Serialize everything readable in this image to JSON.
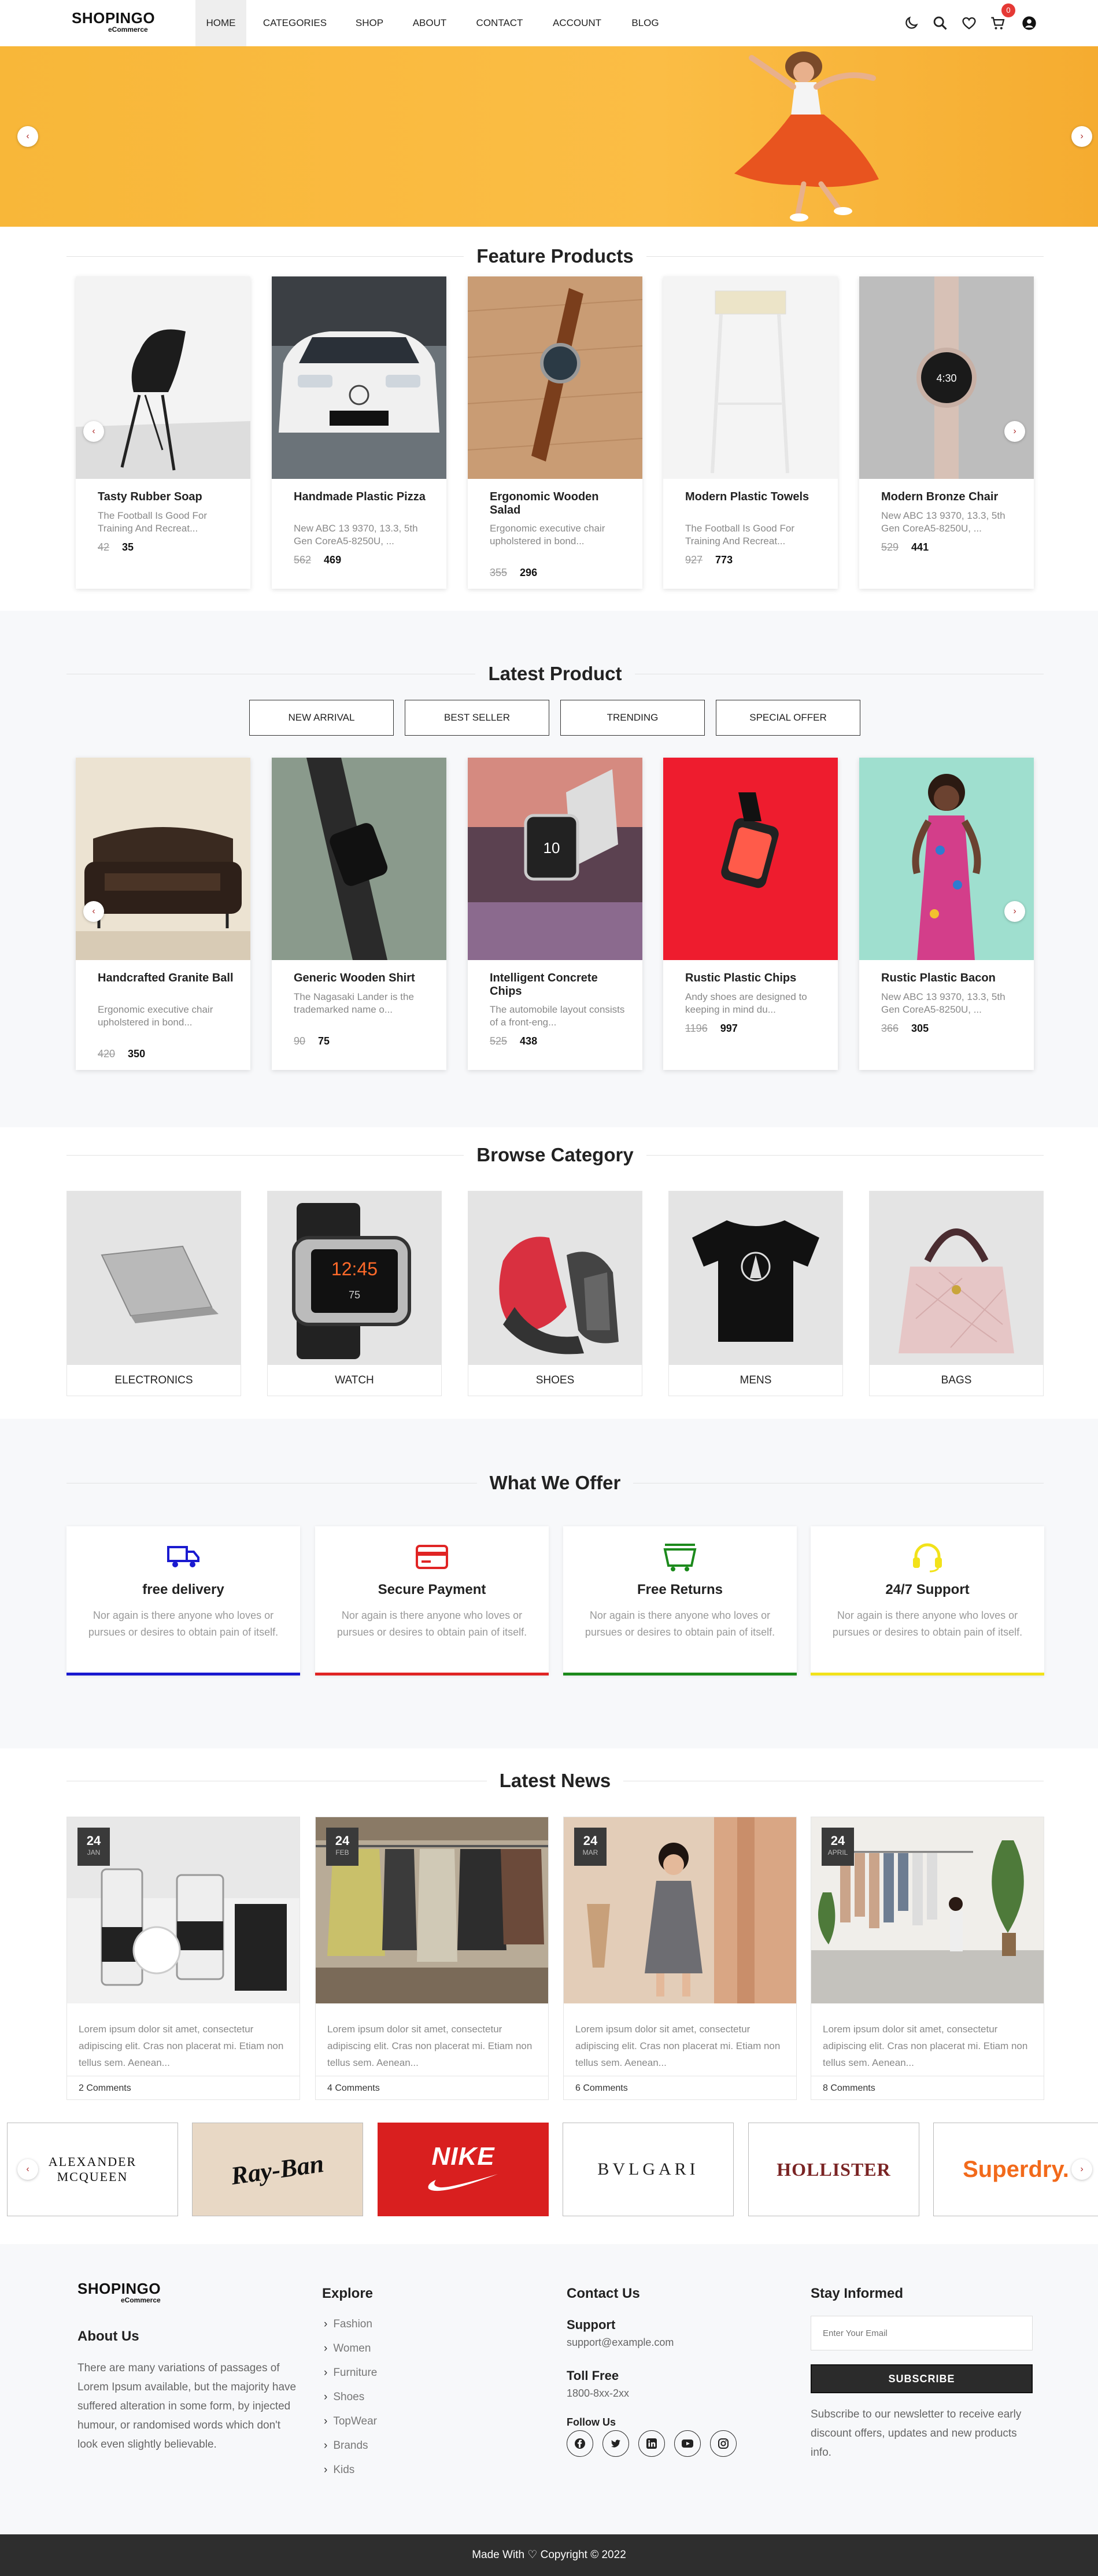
{
  "header": {
    "logo": "SHOPINGO",
    "logo_sub": "eCommerce",
    "nav": [
      "HOME",
      "CATEGORIES",
      "SHOP",
      "ABOUT",
      "CONTACT",
      "ACCOUNT",
      "BLOG"
    ],
    "cart_count": "0",
    "icons": [
      "moon-icon",
      "search-icon",
      "heart-icon",
      "cart-icon",
      "user-icon"
    ]
  },
  "hero": {
    "arrows": [
      "chevron-left-icon",
      "chevron-right-icon"
    ]
  },
  "feature": {
    "title": "Feature Products",
    "products": [
      {
        "name": "Tasty Rubber Soap",
        "desc": "The Football Is Good For Training And Recreat...",
        "old": "42",
        "price": "35"
      },
      {
        "name": "Handmade Plastic Pizza",
        "desc": "New ABC 13 9370, 13.3, 5th Gen CoreA5-8250U, ...",
        "old": "562",
        "price": "469"
      },
      {
        "name": "Ergonomic Wooden Salad",
        "desc": "Ergonomic executive chair upholstered in bond...",
        "old": "355",
        "price": "296"
      },
      {
        "name": "Modern Plastic Towels",
        "desc": "The Football Is Good For Training And Recreat...",
        "old": "927",
        "price": "773"
      },
      {
        "name": "Modern Bronze Chair",
        "desc": "New ABC 13 9370, 13.3, 5th Gen CoreA5-8250U, ...",
        "old": "529",
        "price": "441"
      }
    ]
  },
  "latest": {
    "title": "Latest Product",
    "tabs": [
      "NEW ARRIVAL",
      "BEST SELLER",
      "TRENDING",
      "SPECIAL OFFER"
    ],
    "products": [
      {
        "name": "Handcrafted Granite Ball",
        "desc": "Ergonomic executive chair upholstered in bond...",
        "old": "420",
        "price": "350"
      },
      {
        "name": "Generic Wooden Shirt",
        "desc": "The Nagasaki Lander is the trademarked name o...",
        "old": "90",
        "price": "75"
      },
      {
        "name": "Intelligent Concrete Chips",
        "desc": "The automobile layout consists of a front-eng...",
        "old": "525",
        "price": "438"
      },
      {
        "name": "Rustic Plastic Chips",
        "desc": "Andy shoes are designed to keeping in mind du...",
        "old": "1196",
        "price": "997"
      },
      {
        "name": "Rustic Plastic Bacon",
        "desc": "New ABC 13 9370, 13.3, 5th Gen CoreA5-8250U, ...",
        "old": "366",
        "price": "305"
      }
    ]
  },
  "category": {
    "title": "Browse Category",
    "items": [
      "ELECTRONICS",
      "WATCH",
      "SHOES",
      "MENS",
      "BAGS"
    ]
  },
  "offer": {
    "title": "What We Offer",
    "items": [
      {
        "title": "free delivery",
        "text": "Nor again is there anyone who loves or pursues or desires to obtain pain of itself.",
        "color": "#1a1ad0",
        "icon": "truck-icon"
      },
      {
        "title": "Secure Payment",
        "text": "Nor again is there anyone who loves or pursues or desires to obtain pain of itself.",
        "color": "#e02424",
        "icon": "credit-card-icon"
      },
      {
        "title": "Free Returns",
        "text": "Nor again is there anyone who loves or pursues or desires to obtain pain of itself.",
        "color": "#1c8a1c",
        "icon": "basket-icon"
      },
      {
        "title": "24/7 Support",
        "text": "Nor again is there anyone who loves or pursues or desires to obtain pain of itself.",
        "color": "#f2e21a",
        "icon": "headset-icon"
      }
    ]
  },
  "news": {
    "title": "Latest News",
    "items": [
      {
        "day": "24",
        "month": "JAN",
        "text": "Lorem ipsum dolor sit amet, consectetur adipiscing elit. Cras non placerat mi. Etiam non tellus sem. Aenean...",
        "comments": "2 Comments"
      },
      {
        "day": "24",
        "month": "FEB",
        "text": "Lorem ipsum dolor sit amet, consectetur adipiscing elit. Cras non placerat mi. Etiam non tellus sem. Aenean...",
        "comments": "4 Comments"
      },
      {
        "day": "24",
        "month": "MAR",
        "text": "Lorem ipsum dolor sit amet, consectetur adipiscing elit. Cras non placerat mi. Etiam non tellus sem. Aenean...",
        "comments": "6 Comments"
      },
      {
        "day": "24",
        "month": "APRIL",
        "text": "Lorem ipsum dolor sit amet, consectetur adipiscing elit. Cras non placerat mi. Etiam non tellus sem. Aenean...",
        "comments": "8 Comments"
      }
    ]
  },
  "brands": [
    "ALEXANDER MCQUEEN",
    "Ray-Ban",
    "NIKE",
    "BVLGARI",
    "HOLLISTER",
    "Superdry."
  ],
  "footer": {
    "logo": "SHOPINGO",
    "logo_sub": "eCommerce",
    "about_title": "About Us",
    "about_text": "There are many variations of passages of Lorem Ipsum available, but the majority have suffered alteration in some form, by injected humour, or randomised words which don't look even slightly believable.",
    "explore_title": "Explore",
    "explore_links": [
      "Fashion",
      "Women",
      "Furniture",
      "Shoes",
      "TopWear",
      "Brands",
      "Kids"
    ],
    "contact_title": "Contact Us",
    "support_label": "Support",
    "support_email": "support@example.com",
    "tollfree_label": "Toll Free",
    "tollfree_number": "1800-8xx-2xx",
    "follow_label": "Follow Us",
    "social_icons": [
      "facebook-icon",
      "twitter-icon",
      "linkedin-icon",
      "youtube-icon",
      "instagram-icon"
    ],
    "newsletter_title": "Stay Informed",
    "email_placeholder": "Enter Your Email",
    "subscribe_label": "SUBSCRIBE",
    "newsletter_text": "Subscribe to our newsletter to receive early discount offers, updates and new products info.",
    "copyright": "Made With ♡ Copyright © 2022"
  }
}
